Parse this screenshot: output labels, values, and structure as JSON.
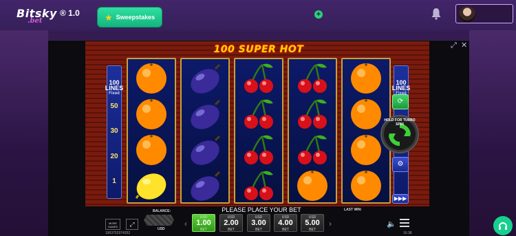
{
  "header": {
    "logo_main": "Bitsky",
    "logo_sub": ".bet",
    "logo_version": "® 1.0",
    "sweep_label": "Sweepstakes",
    "add_label": "+"
  },
  "game": {
    "title": "100 SUPER HOT",
    "lines_left": {
      "top": "100",
      "mid": "LINES",
      "sub": "Fixed",
      "marks": [
        "50",
        "30",
        "20",
        "1"
      ]
    },
    "lines_right": {
      "top": "100",
      "mid": "LINES",
      "sub": "Fixed"
    },
    "turbo_label": "HOLD FOR TURBO SPIN",
    "reels": [
      [
        "orange",
        "orange",
        "orange",
        "lemon"
      ],
      [
        "plum",
        "plum",
        "plum",
        "plum"
      ],
      [
        "cherry",
        "cherry",
        "cherry",
        "cherry"
      ],
      [
        "cherry",
        "cherry",
        "cherry",
        "orange"
      ],
      [
        "orange",
        "orange",
        "orange",
        "orange"
      ]
    ]
  },
  "bottom": {
    "balance_label": "BALANCE:",
    "usd_label": "USD",
    "place_bet": "PLEASE PLACE YOUR BET",
    "last_win": "LAST WIN:",
    "more_games": "MORE GAMES",
    "bets": [
      {
        "usd": "USD",
        "value": "1.00",
        "bet": "BET",
        "active": true
      },
      {
        "usd": "USD",
        "value": "2.00",
        "bet": "BET",
        "active": false
      },
      {
        "usd": "USD",
        "value": "3.00",
        "bet": "BET",
        "active": false
      },
      {
        "usd": "USD",
        "value": "4.00",
        "bet": "BET",
        "active": false
      },
      {
        "usd": "USD",
        "value": "5.00",
        "bet": "BET",
        "active": false
      }
    ],
    "session_id": "1903752974352",
    "clock": "16:38"
  },
  "colors": {
    "accent": "#16d08e",
    "frame_gold": "#c9a13b",
    "reel_bg": "#0c1a6a"
  }
}
